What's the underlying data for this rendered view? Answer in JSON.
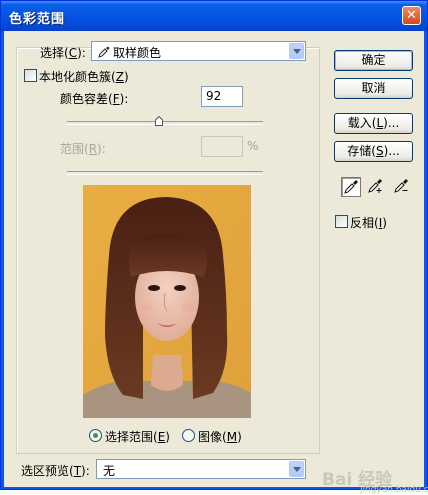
{
  "window": {
    "title": "色彩范围",
    "close_glyph": "✕"
  },
  "select": {
    "label": "选择",
    "key": "C",
    "label_suffix": "):",
    "value": "取样颜色"
  },
  "localized_clusters": {
    "label": "本地化颜色簇",
    "key": "Z",
    "checked": false
  },
  "fuzziness": {
    "label": "颜色容差",
    "key": "F",
    "value": "92",
    "slider_fraction": 0.46
  },
  "range": {
    "label": "范围",
    "key": "R",
    "value": "",
    "unit": "%"
  },
  "preview_mode": {
    "selection": {
      "label": "选择范围",
      "key": "E",
      "checked": true
    },
    "image": {
      "label": "图像",
      "key": "M",
      "checked": false
    }
  },
  "buttons": {
    "ok": "确定",
    "cancel": "取消",
    "load": "载入",
    "load_key": "L",
    "save": "存储",
    "save_key": "S",
    "ellipsis": "...",
    "paren_close": ")"
  },
  "invert": {
    "label": "反相",
    "key": "I",
    "checked": false
  },
  "selection_preview": {
    "label": "选区预览",
    "key": "T",
    "value": "无"
  },
  "watermark": {
    "text": "Bai 经验",
    "sub": "jingyan.baidu.com"
  },
  "icons": [
    "eyedropper-icon",
    "eyedropper-plus-icon",
    "eyedropper-minus-icon"
  ],
  "colors": {
    "title_bar": "#0554e3",
    "dialog_bg": "#ece9d8",
    "photo_bg": "#e9ae43",
    "hair": "#5a2a18"
  }
}
